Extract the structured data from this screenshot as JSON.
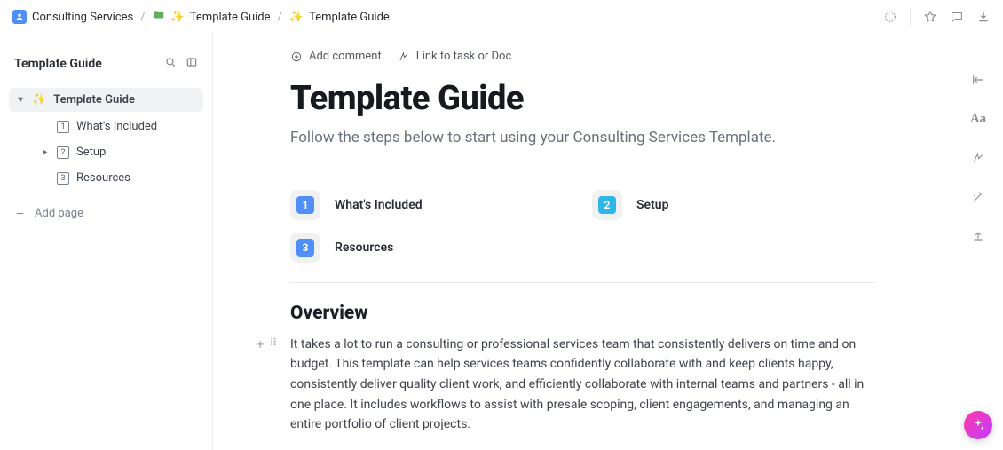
{
  "breadcrumb": {
    "root": "Consulting Services",
    "folder": "Template Guide",
    "page": "Template Guide"
  },
  "sidebar": {
    "title": "Template Guide",
    "root": "Template Guide",
    "items": [
      {
        "num": "1",
        "label": "What's Included"
      },
      {
        "num": "2",
        "label": "Setup"
      },
      {
        "num": "3",
        "label": "Resources"
      }
    ],
    "add_page": "Add page"
  },
  "actions": {
    "add_comment": "Add comment",
    "link_task": "Link to task or Doc"
  },
  "doc": {
    "title": "Template Guide",
    "subtitle": "Follow the steps below to start using your Consulting Services Template.",
    "cards": [
      {
        "num": "1",
        "label": "What's Included"
      },
      {
        "num": "2",
        "label": "Setup"
      },
      {
        "num": "3",
        "label": "Resources"
      }
    ],
    "overview_heading": "Overview",
    "overview_para": "It takes a lot to run a consulting or professional services team that consistently delivers on time and on budget. This template can help services teams confidently collaborate with and keep clients happy, consistently deliver quality client work, and efficiently collaborate with internal teams and partners - all in one place. It includes workflows to assist with presale scoping, client engagements, and managing an entire portfolio of client projects."
  },
  "rail": {
    "typography": "Aa"
  }
}
